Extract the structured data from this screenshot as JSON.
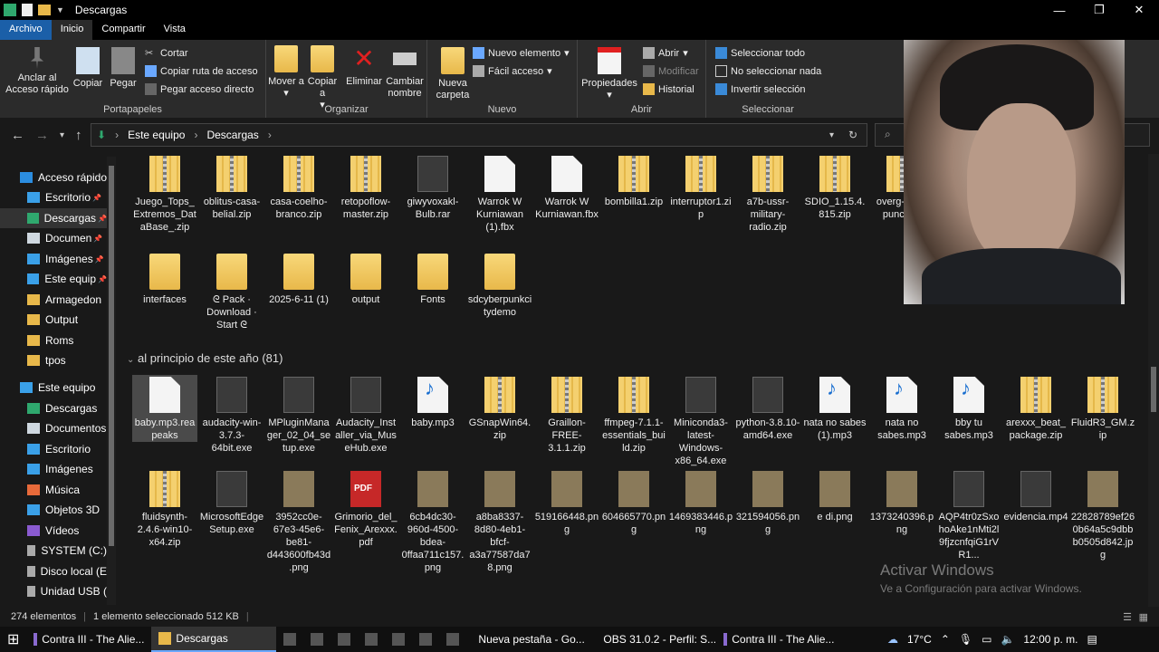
{
  "title": "Descargas",
  "tabs": [
    "Archivo",
    "Inicio",
    "Compartir",
    "Vista"
  ],
  "ribbon": {
    "anclar": "Anclar al Acceso rápido",
    "copiar": "Copiar",
    "pegar": "Pegar",
    "cortar": "Cortar",
    "copiar_ruta": "Copiar ruta de acceso",
    "pegar_acceso": "Pegar acceso directo",
    "portapapeles": "Portapapeles",
    "mover_a": "Mover a",
    "copiar_a": "Copiar a",
    "eliminar": "Eliminar",
    "cambiar_nombre": "Cambiar nombre",
    "organizar": "Organizar",
    "nueva_carpeta": "Nueva carpeta",
    "nuevo_elemento": "Nuevo elemento",
    "facil_acceso": "Fácil acceso",
    "nuevo": "Nuevo",
    "propiedades": "Propiedades",
    "abrir": "Abrir",
    "modificar": "Modificar",
    "historial": "Historial",
    "abrir_group": "Abrir",
    "seleccionar_todo": "Seleccionar todo",
    "no_seleccionar": "No seleccionar nada",
    "invertir": "Invertir selección",
    "seleccionar": "Seleccionar"
  },
  "address": {
    "p1": "Este equipo",
    "p2": "Descargas"
  },
  "sidebar": [
    {
      "label": "Acceso rápido",
      "color": "#2b8de0"
    },
    {
      "label": "Escritorio",
      "color": "#3aa0e8"
    },
    {
      "label": "Descargas",
      "color": "#2fa86e"
    },
    {
      "label": "Documen",
      "color": "#cfd8e0"
    },
    {
      "label": "Imágenes",
      "color": "#3aa0e8"
    },
    {
      "label": "Este equip",
      "color": "#3aa0e8"
    },
    {
      "label": "Armagedon",
      "color": "#e8b84a"
    },
    {
      "label": "Output",
      "color": "#e8b84a"
    },
    {
      "label": "Roms",
      "color": "#e8b84a"
    },
    {
      "label": "tpos",
      "color": "#e8b84a"
    },
    {
      "label": "Este equipo",
      "color": "#3aa0e8"
    },
    {
      "label": "Descargas",
      "color": "#2fa86e"
    },
    {
      "label": "Documentos",
      "color": "#cfd8e0"
    },
    {
      "label": "Escritorio",
      "color": "#3aa0e8"
    },
    {
      "label": "Imágenes",
      "color": "#3aa0e8"
    },
    {
      "label": "Música",
      "color": "#e86a3a"
    },
    {
      "label": "Objetos 3D",
      "color": "#3aa0e8"
    },
    {
      "label": "Vídeos",
      "color": "#8a5ad0"
    },
    {
      "label": "SYSTEM (C:)",
      "color": "#aaa"
    },
    {
      "label": "Disco local (E",
      "color": "#aaa"
    },
    {
      "label": "Unidad USB (",
      "color": "#aaa"
    }
  ],
  "row1": [
    {
      "name": "Juego_Tops_Extremos_DataBase_.zip",
      "type": "zip"
    },
    {
      "name": "oblitus-casa-belial.zip",
      "type": "zip"
    },
    {
      "name": "casa-coelho-branco.zip",
      "type": "zip"
    },
    {
      "name": "retopoflow-master.zip",
      "type": "zip"
    },
    {
      "name": "giwyvoxakl-Bulb.rar",
      "type": "exe"
    },
    {
      "name": "Warrok W Kurniawan (1).fbx",
      "type": "doc"
    },
    {
      "name": "Warrok W Kurniawan.fbx",
      "type": "doc"
    },
    {
      "name": "bombilla1.zip",
      "type": "zip"
    },
    {
      "name": "interruptor1.zip",
      "type": "zip"
    },
    {
      "name": "a7b-ussr-military-radio.zip",
      "type": "zip"
    },
    {
      "name": "SDIO_1.15.4.815.zip",
      "type": "zip"
    },
    {
      "name": "overg-rove-punc-n.z",
      "type": "zip"
    }
  ],
  "row2": [
    {
      "name": "interfaces",
      "type": "folder"
    },
    {
      "name": "ᘓ Pack · Download · Start ᘓ",
      "type": "folder"
    },
    {
      "name": "2025-6-11 (1)",
      "type": "folder"
    },
    {
      "name": "output",
      "type": "folder"
    },
    {
      "name": "Fonts",
      "type": "folder"
    },
    {
      "name": "sdcyberpunkcitydemo",
      "type": "folder"
    }
  ],
  "section_label": "al principio de este año (81)",
  "row3": [
    {
      "name": "baby.mp3.reapeaks",
      "type": "doc"
    },
    {
      "name": "audacity-win-3.7.3-64bit.exe",
      "type": "exe"
    },
    {
      "name": "MPluginManager_02_04_setup.exe",
      "type": "exe"
    },
    {
      "name": "Audacity_Installer_via_MuseHub.exe",
      "type": "exe"
    },
    {
      "name": "baby.mp3",
      "type": "mp3"
    },
    {
      "name": "GSnapWin64.zip",
      "type": "zip"
    },
    {
      "name": "Graillon-FREE-3.1.1.zip",
      "type": "zip"
    },
    {
      "name": "ffmpeg-7.1.1-essentials_build.zip",
      "type": "zip"
    },
    {
      "name": "Miniconda3-latest-Windows-x86_64.exe",
      "type": "exe"
    },
    {
      "name": "python-3.8.10-amd64.exe",
      "type": "exe"
    },
    {
      "name": "nata no sabes (1).mp3",
      "type": "mp3"
    },
    {
      "name": "nata no sabes.mp3",
      "type": "mp3"
    },
    {
      "name": "bby tu sabes.mp3",
      "type": "mp3"
    },
    {
      "name": "arexxx_beat_package.zip",
      "type": "zip"
    },
    {
      "name": "FluidR3_GM.zip",
      "type": "zip"
    }
  ],
  "row4": [
    {
      "name": "fluidsynth-2.4.6-win10-x64.zip",
      "type": "zip"
    },
    {
      "name": "MicrosoftEdgeSetup.exe",
      "type": "exe"
    },
    {
      "name": "3952cc0e-67e3-45e6-be81-d443600fb43d.png",
      "type": "img"
    },
    {
      "name": "Grimorio_del_Fenix_Arexxx.pdf",
      "type": "pdf"
    },
    {
      "name": "6cb4dc30-960d-4500-bdea-0ffaa711c157.png",
      "type": "img"
    },
    {
      "name": "a8ba8337-8d80-4eb1-bfcf-a3a77587da78.png",
      "type": "img"
    },
    {
      "name": "519166448.png",
      "type": "img"
    },
    {
      "name": "604665770.png",
      "type": "img"
    },
    {
      "name": "1469383446.png",
      "type": "img"
    },
    {
      "name": "321594056.png",
      "type": "img"
    },
    {
      "name": "e di.png",
      "type": "img"
    },
    {
      "name": "1373240396.png",
      "type": "img"
    },
    {
      "name": "AQP4tr0zSxohoAke1nMti2l9fjzcnfqiG1rVR1...",
      "type": "exe"
    },
    {
      "name": "evidencia.mp4",
      "type": "exe"
    },
    {
      "name": "22828789ef260b64a5c9dbbb0505d842.jpg",
      "type": "img"
    }
  ],
  "watermark": {
    "line1": "Activar Windows",
    "line2": "Ve a Configuración para activar Windows."
  },
  "status": {
    "count": "274 elementos",
    "selected": "1 elemento seleccionado  512 KB"
  },
  "taskbar": [
    {
      "label": "Contra III - The Alie...",
      "active": false
    },
    {
      "label": "Descargas",
      "active": true
    },
    {
      "label": "Nueva pestaña - Go...",
      "active": false
    },
    {
      "label": "OBS 31.0.2 - Perfil: S...",
      "active": false
    },
    {
      "label": "Contra III - The Alie...",
      "active": false
    }
  ],
  "tray": {
    "temp": "17°C",
    "time": "12:00 p. m."
  }
}
